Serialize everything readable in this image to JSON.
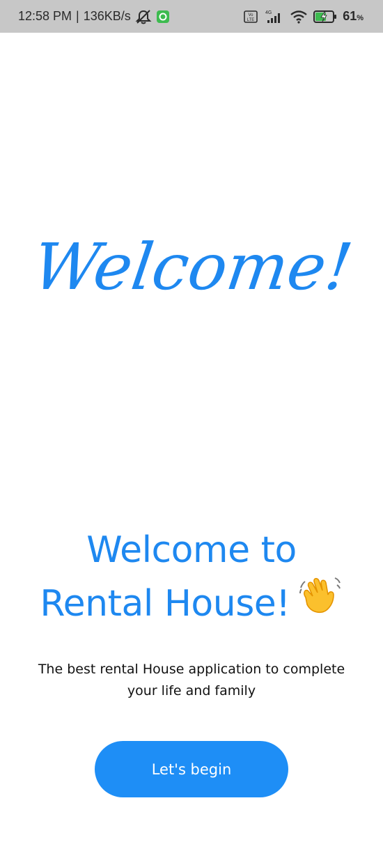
{
  "status_bar": {
    "time": "12:58 PM",
    "separator": "|",
    "network_speed": "136KB/s",
    "network_type": "4G",
    "volte_label": "VoLTE",
    "battery_percent": "61",
    "battery_unit": "%",
    "icons": [
      "mute-icon",
      "app-notification-icon",
      "volte-icon",
      "signal-icon",
      "wifi-icon",
      "battery-charging-icon"
    ]
  },
  "hero": {
    "script_text": "Welcome!",
    "color": "#1e88f0"
  },
  "headline": {
    "line1": "Welcome to",
    "line2": "Rental House!",
    "emoji": "👋",
    "color": "#1e88f0"
  },
  "subtitle": {
    "line1": "The best rental House application to complete",
    "line2": "your life and family"
  },
  "cta": {
    "label": "Let's begin",
    "color": "#1e8ef6"
  }
}
